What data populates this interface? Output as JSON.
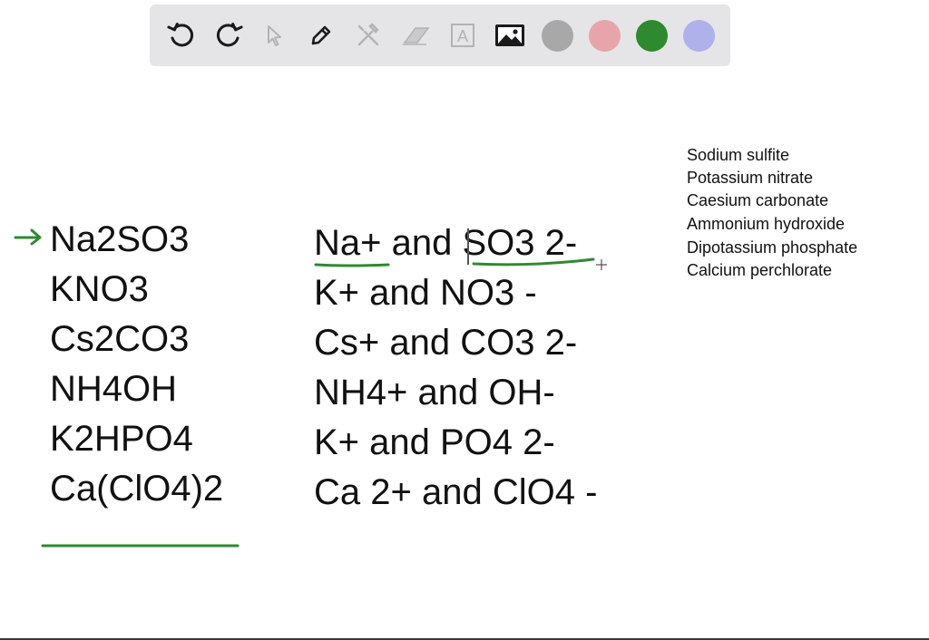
{
  "toolbar": {
    "tools": [
      {
        "icon": "undo-icon"
      },
      {
        "icon": "redo-icon"
      },
      {
        "icon": "pointer-icon"
      },
      {
        "icon": "pen-icon"
      },
      {
        "icon": "tools-icon"
      },
      {
        "icon": "eraser-icon"
      },
      {
        "icon": "text-tool-icon",
        "glyph": "A"
      },
      {
        "icon": "image-icon"
      }
    ],
    "colors": [
      {
        "name": "gray",
        "hex": "#a8a8a8"
      },
      {
        "name": "pink",
        "hex": "#e8a4ab"
      },
      {
        "name": "green",
        "hex": "#2e8a2e"
      },
      {
        "name": "lavender",
        "hex": "#aeb1ea"
      }
    ]
  },
  "formulas": [
    "Na2SO3",
    "KNO3",
    "Cs2CO3",
    "NH4OH",
    "K2HPO4",
    "Ca(ClO4)2"
  ],
  "ions": [
    "Na+ and SO3 2-",
    "K+ and NO3 -",
    "Cs+ and CO3 2-",
    "NH4+ and OH-",
    "K+ and PO4 2-",
    "Ca 2+ and ClO4 -"
  ],
  "names": [
    "Sodium sulfite",
    "Potassium nitrate",
    "Caesium carbonate",
    "Ammonium hydroxide",
    "Dipotassium phosphate",
    "Calcium perchlorate"
  ],
  "annotation_color": "#2e8a2e"
}
